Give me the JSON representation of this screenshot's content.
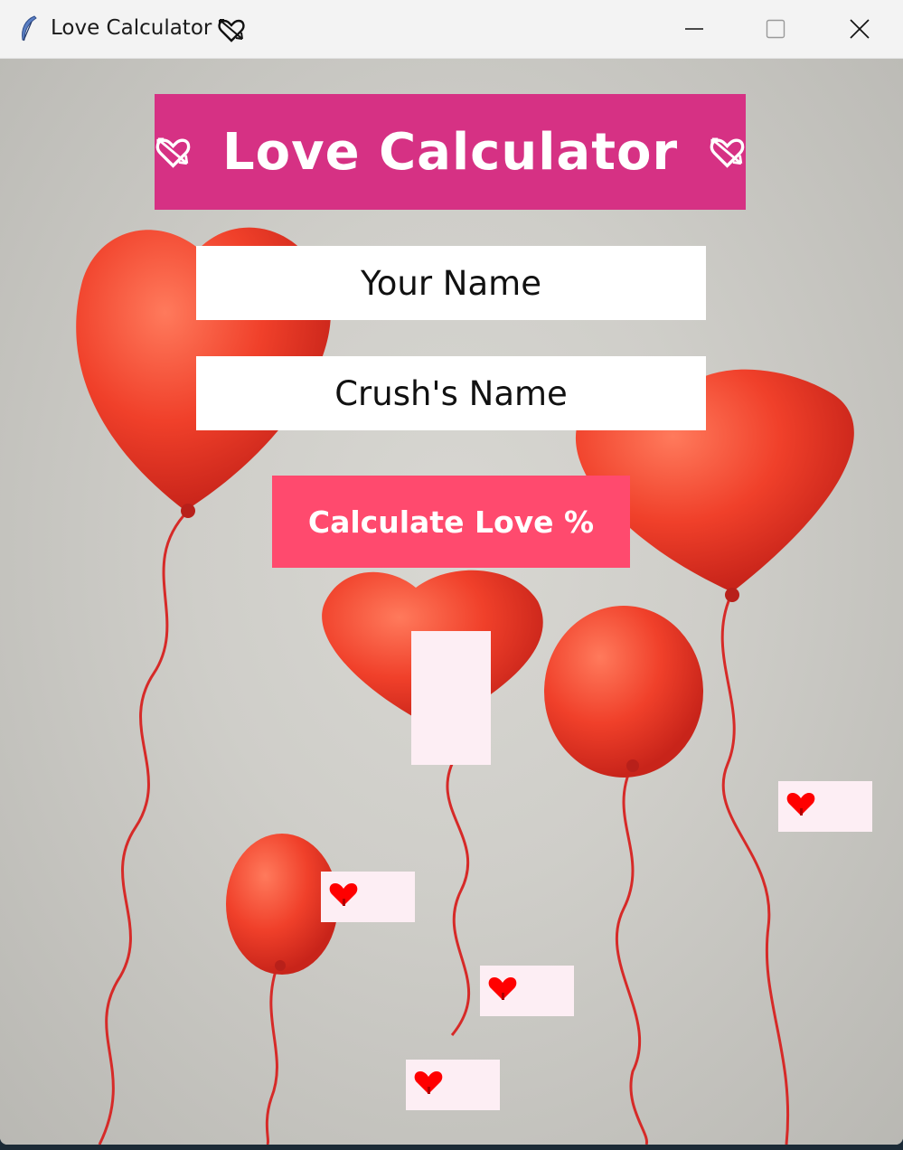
{
  "window": {
    "title": "Love Calculator",
    "title_icon": "heart-with-arrow-icon",
    "app_icon": "feather-icon",
    "controls": [
      "minimize-icon",
      "maximize-icon",
      "close-icon"
    ]
  },
  "header": {
    "title": "Love Calculator",
    "left_icon": "heart-with-arrow-icon",
    "right_icon": "heart-with-arrow-icon",
    "background": "#d63184"
  },
  "form": {
    "your_name_placeholder": "Your Name",
    "crush_name_placeholder": "Crush's Name",
    "calculate_label": "Calculate Love %",
    "button_color": "#ff4a6e"
  },
  "result": {
    "text": ""
  },
  "decorations": {
    "heart_labels": [
      "heart-icon",
      "heart-icon",
      "heart-icon",
      "heart-icon"
    ],
    "heart_color": "#ff0000",
    "label_background": "#fdeef4"
  }
}
